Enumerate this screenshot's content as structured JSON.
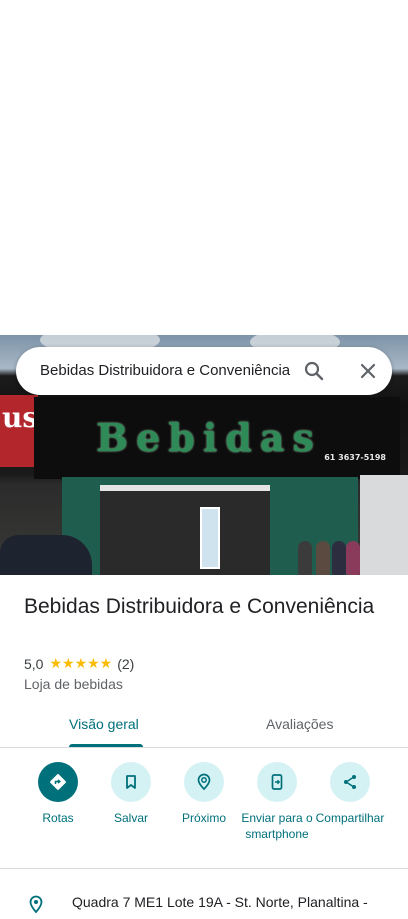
{
  "search": {
    "query": "Bebidas Distribuidora e Conveniência"
  },
  "photo": {
    "sign_text": "Bebidas",
    "sign_phone": "61 3637-5198",
    "left_sign_text": "us"
  },
  "place": {
    "name": "Bebidas Distribuidora e Conveniência",
    "rating": "5,0",
    "stars": "★★★★★",
    "review_count": "(2)",
    "category": "Loja de bebidas"
  },
  "tabs": [
    {
      "label": "Visão geral",
      "selected": true
    },
    {
      "label": "Avaliações",
      "selected": false
    }
  ],
  "actions": [
    {
      "label": "Rotas",
      "icon": "directions-icon"
    },
    {
      "label": "Salvar",
      "icon": "bookmark-icon"
    },
    {
      "label": "Próximo",
      "icon": "nearby-icon"
    },
    {
      "label": "Enviar para o smartphone",
      "icon": "send-to-phone-icon"
    },
    {
      "label": "Compartilhar",
      "icon": "share-icon"
    }
  ],
  "address": {
    "text": "Quadra 7 ME1 Lote 19A - St. Norte, Planaltina -",
    "icon": "location-pin-icon"
  },
  "colors": {
    "accent": "#00707a",
    "accent_light": "#d4f2f4",
    "star": "#fbbc04"
  }
}
